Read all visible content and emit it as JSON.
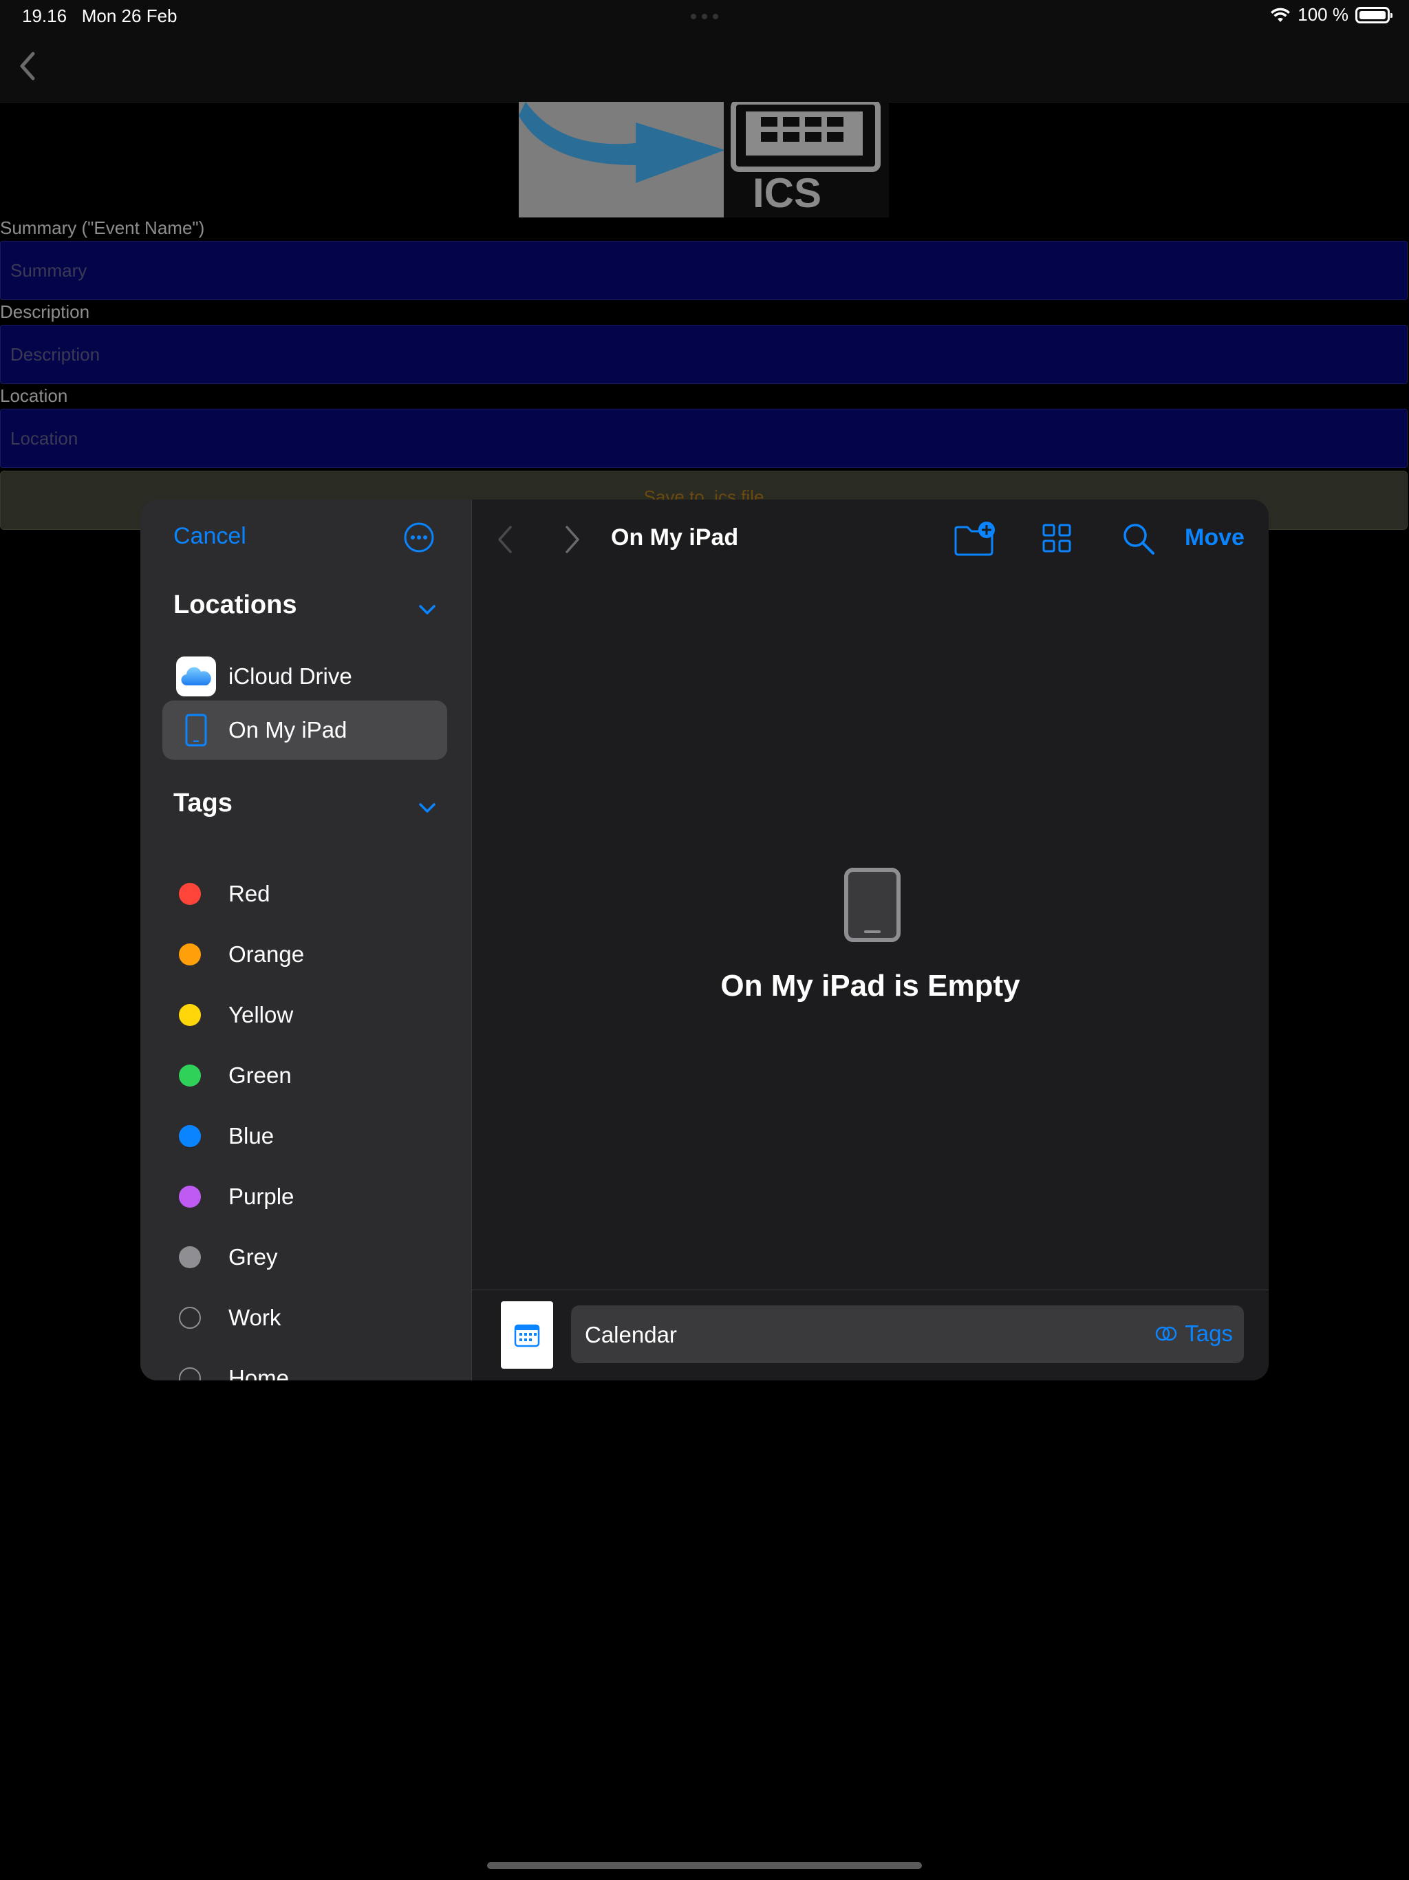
{
  "status_bar": {
    "time": "19.16",
    "date": "Mon 26 Feb",
    "battery": "100 %"
  },
  "form": {
    "summary_label": "Summary (\"Event Name\")",
    "summary_placeholder": "Summary",
    "description_label": "Description",
    "description_placeholder": "Description",
    "location_label": "Location",
    "location_placeholder": "Location",
    "save_button": "Save to .ics file",
    "header_image_text": "ICS"
  },
  "picker": {
    "cancel": "Cancel",
    "locations_header": "Locations",
    "locations": [
      {
        "label": "iCloud Drive",
        "icon": "icloud-drive-icon",
        "selected": false
      },
      {
        "label": "On My iPad",
        "icon": "ipad-icon",
        "selected": true
      }
    ],
    "tags_header": "Tags",
    "tags": [
      {
        "label": "Red",
        "color": "#ff453a"
      },
      {
        "label": "Orange",
        "color": "#ff9f0a"
      },
      {
        "label": "Yellow",
        "color": "#ffd60a"
      },
      {
        "label": "Green",
        "color": "#30d158"
      },
      {
        "label": "Blue",
        "color": "#0a84ff"
      },
      {
        "label": "Purple",
        "color": "#bf5af2"
      },
      {
        "label": "Grey",
        "color": "#8e8e93"
      },
      {
        "label": "Work",
        "color": ""
      },
      {
        "label": "Home",
        "color": ""
      }
    ],
    "title": "On My iPad",
    "move": "Move",
    "empty_message": "On My iPad is Empty",
    "filename": "Calendar",
    "tags_button": "Tags"
  },
  "colors": {
    "accent": "#0a84ff",
    "sidebar_bg": "#2c2c2e",
    "pane_bg": "#1c1c1e",
    "input_bg": "#04044a"
  }
}
